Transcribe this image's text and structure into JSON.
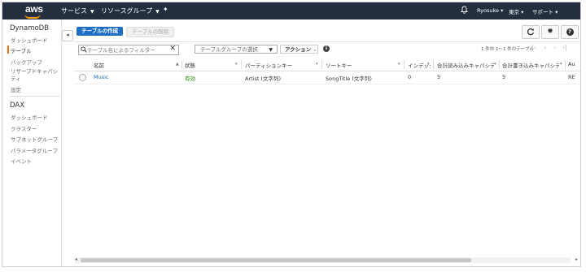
{
  "topbar": {
    "logo": "aws",
    "services": "サービス",
    "resource_groups": "リソースグループ",
    "pin_icon": "pin-icon",
    "bell_icon": "bell-icon",
    "user": "Ryosuke",
    "region": "東京",
    "support": "サポート",
    "colors": {
      "bg": "#232f3e",
      "accent": "#ff9900"
    }
  },
  "sidebar": {
    "dynamodb": {
      "title": "DynamoDB",
      "items": [
        "ダッシュボード",
        "テーブル",
        "バックアップ",
        "リザーブドキャパシティ",
        "設定"
      ],
      "active": "テーブル"
    },
    "dax": {
      "title": "DAX",
      "items": [
        "ダッシュボード",
        "クラスター",
        "サブネットグループ",
        "パラメータグループ",
        "イベント"
      ]
    }
  },
  "toolbar": {
    "create_table": "テーブルの作成",
    "delete_table": "テーブルの削除",
    "refresh_icon": "refresh-icon",
    "settings_icon": "gear-icon",
    "help_icon": "help-icon"
  },
  "filter": {
    "search_placeholder": "テーブル名によるフィルター",
    "group_select": "テーブルグループの選択",
    "actions": "アクション",
    "pager": "1 件中 1～1 件のテーブル"
  },
  "table": {
    "columns": [
      "名前",
      "状態",
      "パーティションキー",
      "ソートキー",
      "インデックス",
      "合計読み込みキャパシティ",
      "合計書き込みキャパシティ",
      "Au"
    ],
    "rows": [
      {
        "name": "Music",
        "status": "有効",
        "partition_key": "Artist (文字列)",
        "sort_key": "SongTitle (文字列)",
        "indexes": "0",
        "read_capacity": "5",
        "write_capacity": "5",
        "auto": "RE"
      }
    ]
  },
  "colors": {
    "primary": "#1f6fc5",
    "link": "#1a6bb0",
    "status_active": "#1d8102",
    "nav_active": "#ec7211"
  }
}
